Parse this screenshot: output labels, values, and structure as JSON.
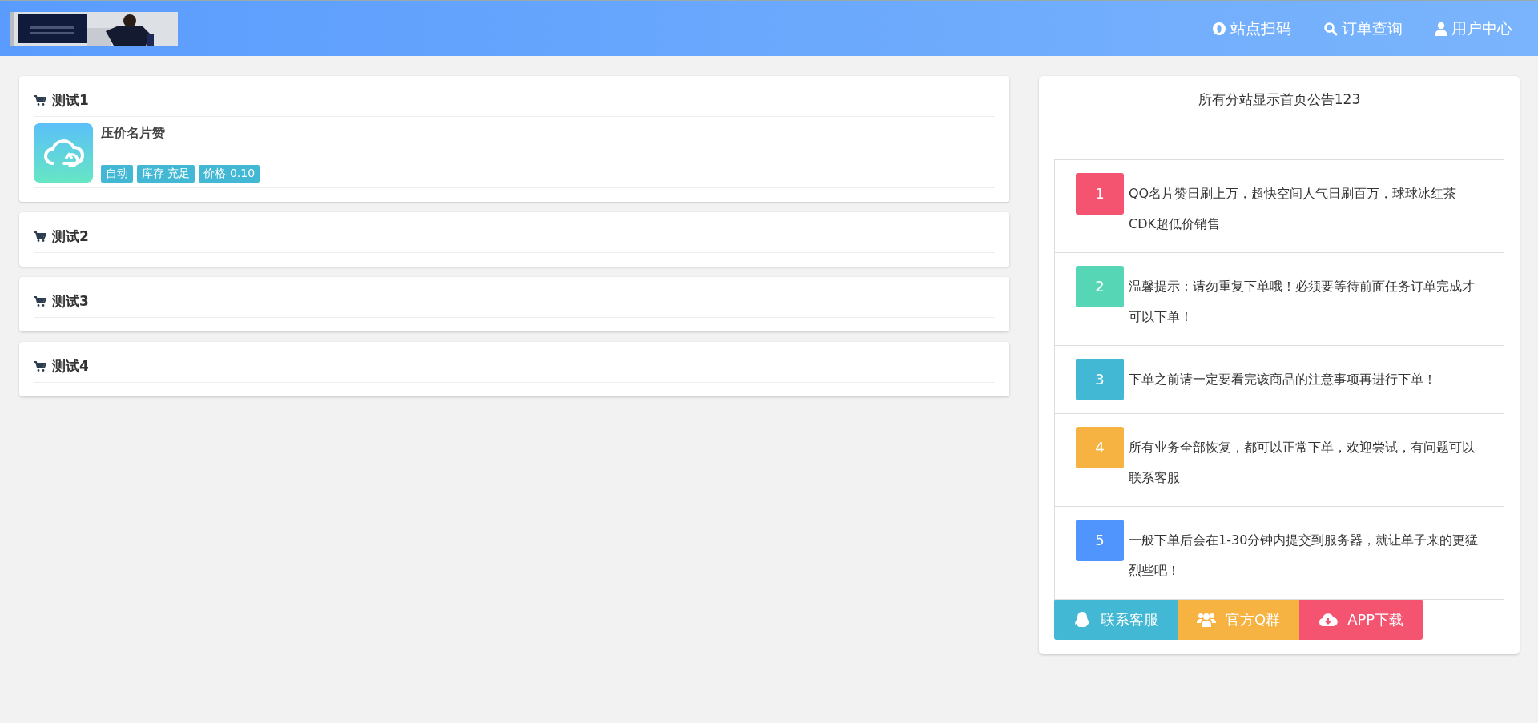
{
  "header": {
    "nav": [
      {
        "label": "站点扫码"
      },
      {
        "label": "订单查询"
      },
      {
        "label": "用户中心"
      }
    ]
  },
  "categories": [
    {
      "title": "测试1",
      "products": [
        {
          "name": "压价名片赞",
          "tags": [
            "自动",
            "库存 充足",
            "价格 0.10"
          ]
        }
      ]
    },
    {
      "title": "测试2"
    },
    {
      "title": "测试3"
    },
    {
      "title": "测试4"
    }
  ],
  "notice": {
    "title": "所有分站显示首页公告123",
    "items": [
      {
        "number": "1",
        "color": "#f4546f",
        "text": "QQ名片赞日刷上万，超快空间人气日刷百万，球球冰红茶CDK超低价销售"
      },
      {
        "number": "2",
        "color": "#56d6b5",
        "text": "温馨提示：请勿重复下单哦！必须要等待前面任务订单完成才可以下单！"
      },
      {
        "number": "3",
        "color": "#42b8d4",
        "text": "下单之前请一定要看完该商品的注意事项再进行下单！"
      },
      {
        "number": "4",
        "color": "#f7b342",
        "text": "所有业务全部恢复，都可以正常下单，欢迎尝试，有问题可以联系客服"
      },
      {
        "number": "5",
        "color": "#4f95fd",
        "text": "一般下单后会在1-30分钟内提交到服务器，就让单子来的更猛烈些吧！"
      }
    ],
    "buttons": [
      {
        "label": "联系客服",
        "color": "#42b8d4"
      },
      {
        "label": "官方Q群",
        "color": "#f7b342"
      },
      {
        "label": "APP下载",
        "color": "#f4546f"
      }
    ]
  }
}
